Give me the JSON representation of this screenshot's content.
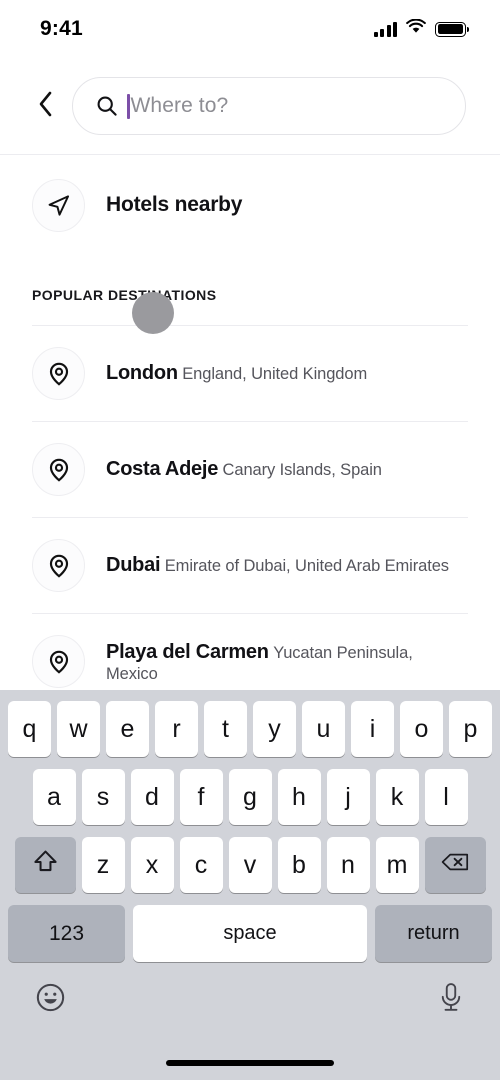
{
  "status_bar": {
    "time": "9:41",
    "signal_icon": "cellular-signal-icon",
    "wifi_icon": "wifi-icon",
    "battery_icon": "battery-full-icon"
  },
  "header": {
    "back_icon": "chevron-left-icon",
    "search": {
      "icon": "search-icon",
      "placeholder": "Where to?",
      "value": "",
      "caret_color": "#7c4fa8"
    }
  },
  "nearby": {
    "icon": "navigation-arrow-icon",
    "label": "Hotels nearby"
  },
  "popular": {
    "section_title": "POPULAR DESTINATIONS",
    "items": [
      {
        "icon": "map-pin-icon",
        "name": "London",
        "subtitle": "England, United Kingdom"
      },
      {
        "icon": "map-pin-icon",
        "name": "Costa Adeje",
        "subtitle": "Canary Islands, Spain"
      },
      {
        "icon": "map-pin-icon",
        "name": "Dubai",
        "subtitle": "Emirate of Dubai, United Arab Emirates"
      },
      {
        "icon": "map-pin-icon",
        "name": "Playa del Carmen",
        "subtitle": "Yucatan Peninsula, Mexico"
      }
    ]
  },
  "keyboard": {
    "row1": [
      "q",
      "w",
      "e",
      "r",
      "t",
      "y",
      "u",
      "i",
      "o",
      "p"
    ],
    "row2": [
      "a",
      "s",
      "d",
      "f",
      "g",
      "h",
      "j",
      "k",
      "l"
    ],
    "row3": [
      "z",
      "x",
      "c",
      "v",
      "b",
      "n",
      "m"
    ],
    "shift_icon": "shift-arrow-icon",
    "backspace_icon": "backspace-delete-icon",
    "numbers_label": "123",
    "space_label": "space",
    "return_label": "return",
    "emoji_icon": "emoji-smiley-icon",
    "dictation_icon": "microphone-icon"
  },
  "colors": {
    "keyboard_background": "#d1d3d9",
    "modifier_key": "#aeb2bb",
    "cursor_dot": "#9a9a9e"
  }
}
